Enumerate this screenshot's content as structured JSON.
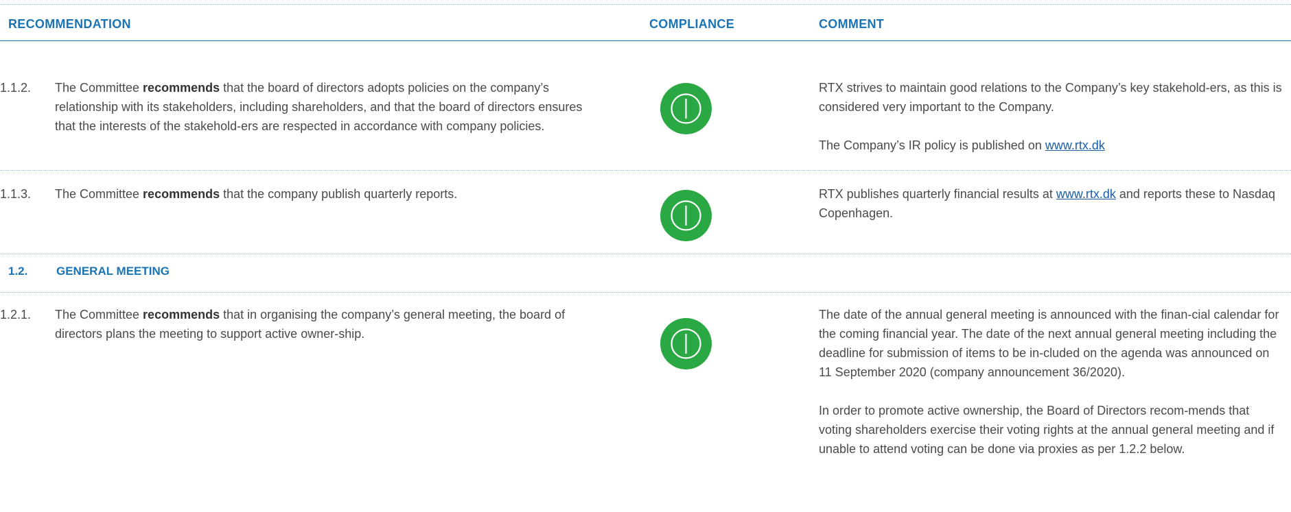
{
  "header": {
    "recommendation": "RECOMMENDATION",
    "compliance": "COMPLIANCE",
    "comment": "COMMENT"
  },
  "colors": {
    "accent": "#1a73b5",
    "compliance_green": "#2aa843",
    "link": "#1a5ea8"
  },
  "rows": [
    {
      "num": "1.1.2.",
      "pre": "The Committee ",
      "bold": "recommends",
      "post": " that the board of directors adopts policies on the company’s relationship with its stakeholders, including shareholders, and that the board of directors ensures that the interests of the stakehold-ers are respected in accordance with company policies.",
      "compliance_icon": "check-circle-icon",
      "comment_p1": "RTX strives to maintain good relations to the Company’s key stakehold-ers, as this is considered very important to the Company.",
      "comment_p2_pre": "The Company’s IR policy is published on ",
      "comment_p2_link": "www.rtx.dk"
    },
    {
      "num": "1.1.3.",
      "pre": "The Committee ",
      "bold": "recommends",
      "post": " that the company publish quarterly reports.",
      "compliance_icon": "check-circle-icon",
      "comment_pre": "RTX publishes quarterly financial results at ",
      "comment_link": "www.rtx.dk",
      "comment_post": " and reports these to Nasdaq Copenhagen."
    },
    {
      "num": "1.2.1.",
      "pre": "The Committee ",
      "bold": "recommends",
      "post": " that in organising the company’s general meeting, the board of directors plans the meeting to support active owner-ship.",
      "compliance_icon": "check-circle-icon",
      "comment_p1": "The date of the annual general meeting is announced with the finan-cial calendar for the coming financial year. The date of the next annual general meeting including the deadline for submission of items to be in-cluded on the agenda was announced on 11 September 2020 (company announcement 36/2020).",
      "comment_p2": "In order to promote active ownership, the Board of Directors recom-mends that voting shareholders exercise their voting rights at the annual general meeting and if unable to attend voting can be done via proxies as per 1.2.2 below."
    }
  ],
  "section": {
    "num": "1.2.",
    "title": "GENERAL MEETING"
  }
}
